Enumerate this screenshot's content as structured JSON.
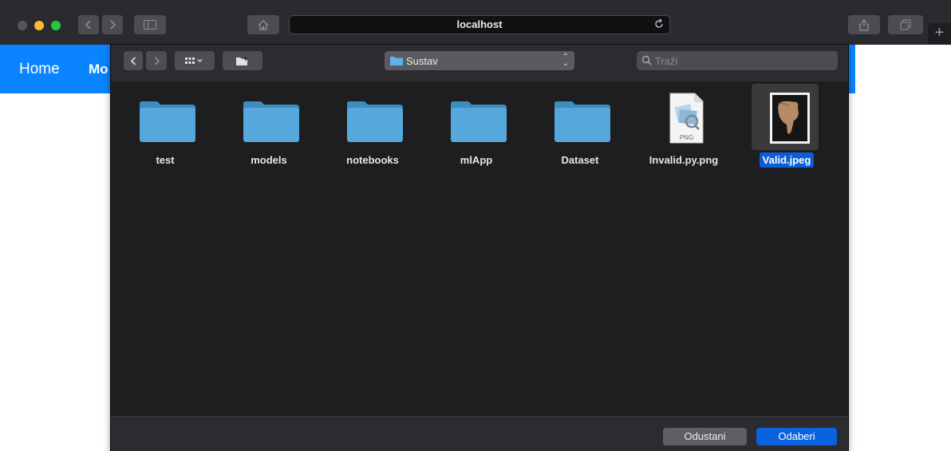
{
  "browser": {
    "url": "localhost",
    "new_tab_label": "+"
  },
  "page": {
    "nav": {
      "home": "Home",
      "second_item": "Mo"
    }
  },
  "dialog": {
    "location": "Sustav",
    "search_placeholder": "Traži",
    "items": [
      {
        "name": "test",
        "type": "folder"
      },
      {
        "name": "models",
        "type": "folder"
      },
      {
        "name": "notebooks",
        "type": "folder"
      },
      {
        "name": "mlApp",
        "type": "folder"
      },
      {
        "name": "Dataset",
        "type": "folder"
      },
      {
        "name": "Invalid.py.png",
        "type": "png-file",
        "badge": "PNG"
      },
      {
        "name": "Valid.jpeg",
        "type": "jpeg-file",
        "selected": true
      }
    ],
    "cancel_label": "Odustani",
    "choose_label": "Odaberi"
  },
  "colors": {
    "nav_blue": "#0a84ff",
    "select_blue": "#0a5ed7",
    "folder": "#4aa3d8"
  }
}
